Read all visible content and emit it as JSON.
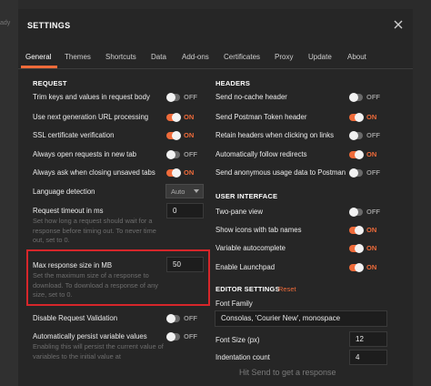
{
  "background": {
    "left_fragment": "ady",
    "bottom_fragment": "Hit Send to get a response"
  },
  "modal": {
    "title": "SETTINGS"
  },
  "tabs": [
    {
      "label": "General",
      "active": true
    },
    {
      "label": "Themes"
    },
    {
      "label": "Shortcuts"
    },
    {
      "label": "Data"
    },
    {
      "label": "Add-ons"
    },
    {
      "label": "Certificates"
    },
    {
      "label": "Proxy"
    },
    {
      "label": "Update"
    },
    {
      "label": "About"
    }
  ],
  "request": {
    "title": "REQUEST",
    "trim_keys": {
      "label": "Trim keys and values in request body",
      "state": "OFF"
    },
    "next_gen_url": {
      "label": "Use next generation URL processing",
      "state": "ON"
    },
    "ssl_verification": {
      "label": "SSL certificate verification",
      "state": "ON"
    },
    "always_open_new_tab": {
      "label": "Always open requests in new tab",
      "state": "OFF"
    },
    "ask_closing_unsaved": {
      "label": "Always ask when closing unsaved tabs",
      "state": "ON"
    },
    "language_detection": {
      "label": "Language detection",
      "value": "Auto"
    },
    "request_timeout": {
      "label": "Request timeout in ms",
      "value": "0",
      "description": "Set how long a request should wait for a response before timing out. To never time out, set to 0."
    },
    "max_response_size": {
      "label": "Max response size in MB",
      "value": "50",
      "description": "Set the maximum size of a response to download. To download a response of any size, set to 0."
    },
    "disable_validation": {
      "label": "Disable Request Validation",
      "state": "OFF"
    },
    "auto_persist": {
      "label": "Automatically persist variable values",
      "state": "OFF",
      "description": "Enabling this will persist the current value of variables to the initial value at"
    }
  },
  "headers": {
    "title": "HEADERS",
    "no_cache": {
      "label": "Send no-cache header",
      "state": "OFF"
    },
    "postman_token": {
      "label": "Send Postman Token header",
      "state": "ON"
    },
    "retain_headers": {
      "label": "Retain headers when clicking on links",
      "state": "OFF"
    },
    "follow_redirects": {
      "label": "Automatically follow redirects",
      "state": "ON"
    },
    "anonymous_usage": {
      "label": "Send anonymous usage data to Postman",
      "state": "OFF"
    }
  },
  "user_interface": {
    "title": "USER INTERFACE",
    "two_pane": {
      "label": "Two-pane view",
      "state": "OFF"
    },
    "icons_tab_names": {
      "label": "Show icons with tab names",
      "state": "ON"
    },
    "variable_autocomplete": {
      "label": "Variable autocomplete",
      "state": "ON"
    },
    "launchpad": {
      "label": "Enable Launchpad",
      "state": "ON"
    }
  },
  "editor": {
    "title": "EDITOR SETTINGS",
    "reset_label": "Reset",
    "font_family": {
      "label": "Font Family",
      "value": "Consolas, 'Courier New', monospace"
    },
    "font_size": {
      "label": "Font Size (px)",
      "value": "12"
    },
    "indentation": {
      "label": "Indentation count",
      "value": "4"
    }
  },
  "colors": {
    "accent": "#ef6b3a",
    "highlight_border": "#d6262a",
    "background": "#262626"
  }
}
